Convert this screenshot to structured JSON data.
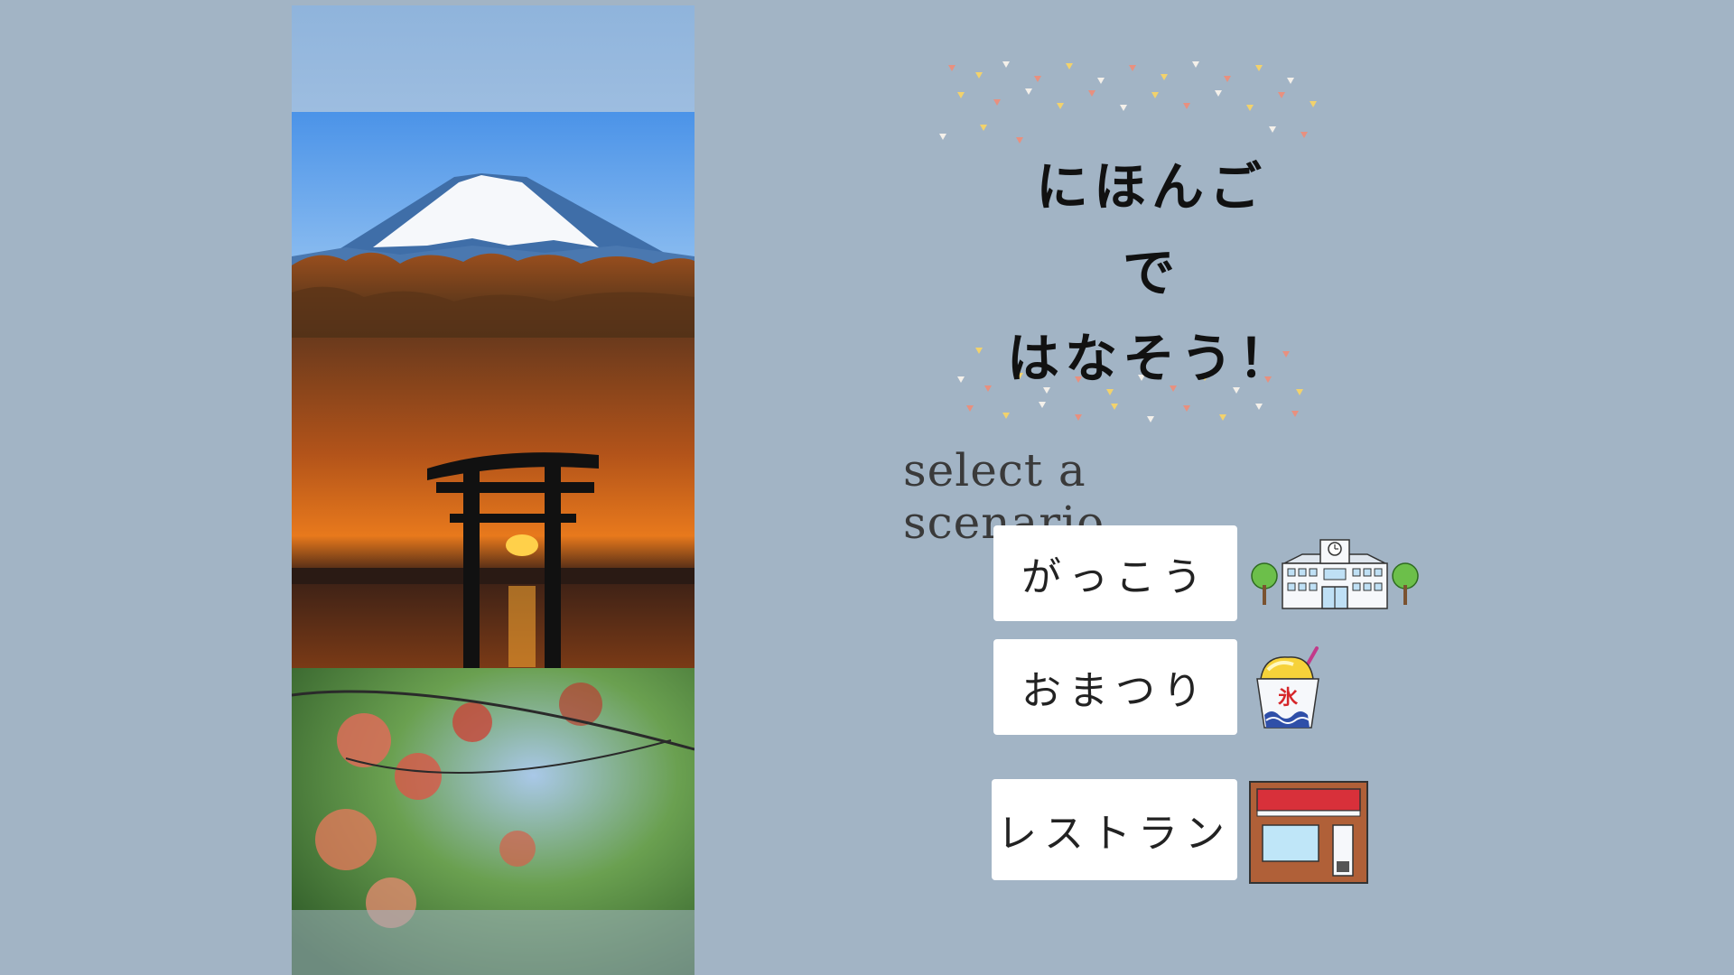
{
  "title": {
    "lines": [
      "にほんご",
      "で",
      "はなそう！"
    ]
  },
  "subtitle": "select a scenario",
  "scenarios": [
    {
      "label": "がっこう",
      "icon": "school-building-icon"
    },
    {
      "label": "おまつり",
      "icon": "shaved-ice-icon"
    },
    {
      "label": "レストラン",
      "icon": "restaurant-storefront-icon"
    }
  ],
  "photos": [
    {
      "subject": "mount-fuji-photo"
    },
    {
      "subject": "torii-sunset-photo"
    },
    {
      "subject": "autumn-maple-photo"
    }
  ],
  "colors": {
    "background": "#a2b4c5",
    "button_bg": "#ffffff",
    "confetti": [
      "#e8907f",
      "#f2d26c",
      "#f4f0ea"
    ]
  },
  "ice_kanji": "氷"
}
